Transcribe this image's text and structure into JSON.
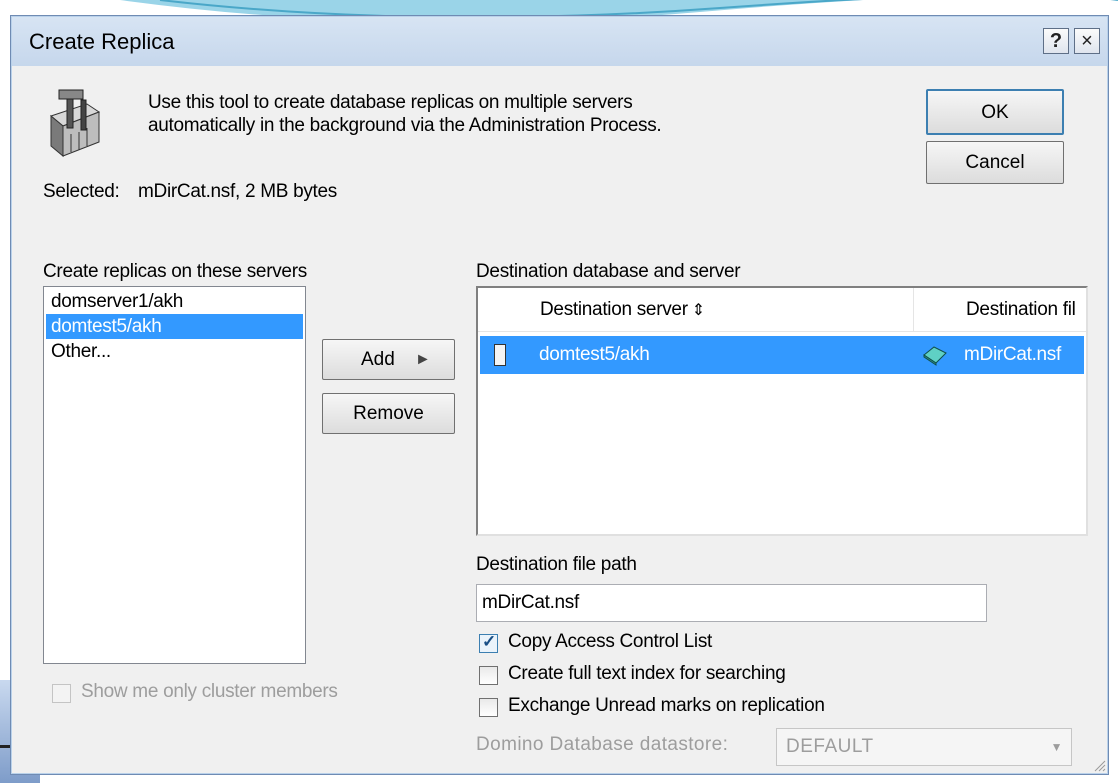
{
  "window": {
    "title": "Create Replica",
    "help_glyph": "?",
    "close_glyph": "×"
  },
  "intro": {
    "line1": "Use this tool to create database replicas on multiple servers",
    "line2": "automatically in the background via the Administration Process."
  },
  "buttons": {
    "ok": "OK",
    "cancel": "Cancel",
    "add": "Add",
    "add_arrow": "►",
    "remove": "Remove"
  },
  "selected_label": "Selected:",
  "selected_value": "mDirCat.nsf, 2 MB bytes",
  "servers": {
    "label": "Create replicas on these servers",
    "items": [
      {
        "label": "domserver1/akh",
        "selected": false
      },
      {
        "label": "domtest5/akh",
        "selected": true
      },
      {
        "label": "Other...",
        "selected": false
      }
    ]
  },
  "destination": {
    "label": "Destination database and server",
    "columns": {
      "server": "Destination server",
      "file": "Destination fil"
    },
    "sort_glyph": "⇕",
    "rows": [
      {
        "server": "domtest5/akh",
        "file": "mDirCat.nsf"
      }
    ]
  },
  "file_path": {
    "label": "Destination file path",
    "value": "mDirCat.nsf"
  },
  "options": {
    "copy_acl": {
      "label": "Copy Access Control List",
      "checked": true
    },
    "full_text_index": {
      "label": "Create full text index for searching",
      "checked": false
    },
    "exchange_unread": {
      "label": "Exchange Unread marks on replication",
      "checked": false
    }
  },
  "cluster_only": {
    "label": "Show me only cluster members",
    "checked": false,
    "enabled": false
  },
  "datastore": {
    "label": "Domino Database datastore:",
    "value": "DEFAULT",
    "enabled": false
  },
  "colors": {
    "selection": "#3399ff",
    "title_bar": "#cfdeef",
    "dialog_bg": "#f0f0f0"
  }
}
